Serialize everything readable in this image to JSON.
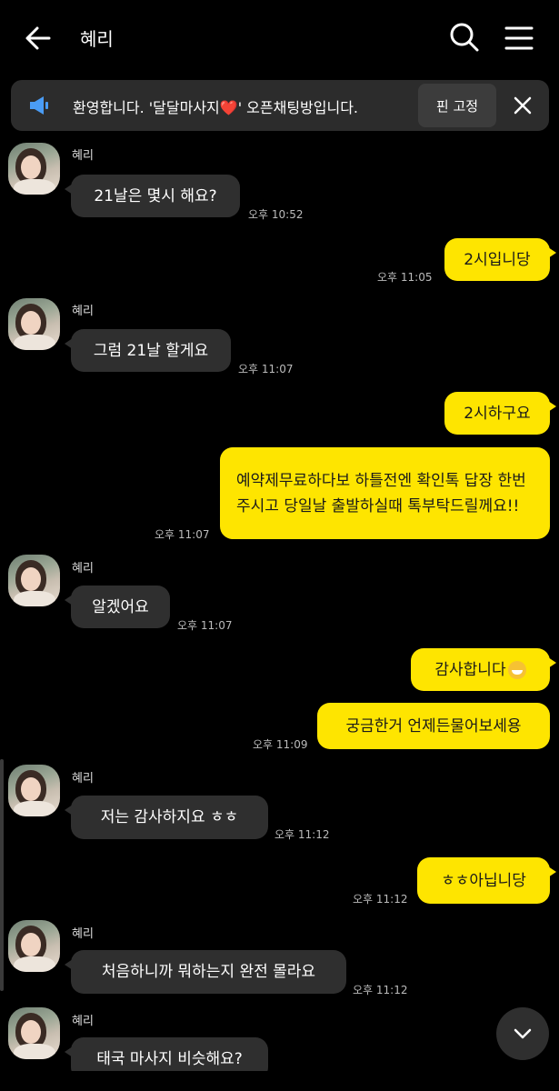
{
  "header": {
    "title": "혜리"
  },
  "notice": {
    "text": "환영합니다. '달달마사지❤️' 오픈채팅방입니다.",
    "pin_label": "핀 고정"
  },
  "colors": {
    "background": "#000000",
    "incoming_bubble": "#2f2f2f",
    "outgoing_bubble": "#fee500",
    "notice_bg": "#2c2c2c"
  },
  "icons": [
    "back-arrow-icon",
    "search-icon",
    "menu-icon",
    "megaphone-icon",
    "close-icon",
    "chevron-down-icon"
  ],
  "messages": [
    {
      "sender": "혜리",
      "text": "21날은 몇시 해요?",
      "time": "오후 10:52"
    },
    {
      "text": "2시입니당",
      "time": "오후 11:05"
    },
    {
      "sender": "혜리",
      "text": "그럼 21날 할게요",
      "time": "오후 11:07"
    },
    {
      "text": "2시하구요"
    },
    {
      "text": "예약제무료하다보 하틀전엔 확인톡 답장 한번주시고 당일날 출발하실때 톡부탁드릴께요!!",
      "time": "오후 11:07"
    },
    {
      "sender": "혜리",
      "text": "알겠어요",
      "time": "오후 11:07"
    },
    {
      "text": "감사합니다"
    },
    {
      "text": "궁금한거 언제든물어보세용",
      "time": "오후 11:09"
    },
    {
      "sender": "혜리",
      "text": "저는 감사하지요 ㅎㅎ",
      "time": "오후 11:12"
    },
    {
      "text": "ㅎㅎ아닙니당",
      "time": "오후 11:12"
    },
    {
      "sender": "혜리",
      "text": "처음하니까 뭐하는지 완전 몰라요",
      "time": "오후 11:12"
    },
    {
      "sender": "혜리",
      "text": "태국 마사지 비슷해요?"
    }
  ]
}
